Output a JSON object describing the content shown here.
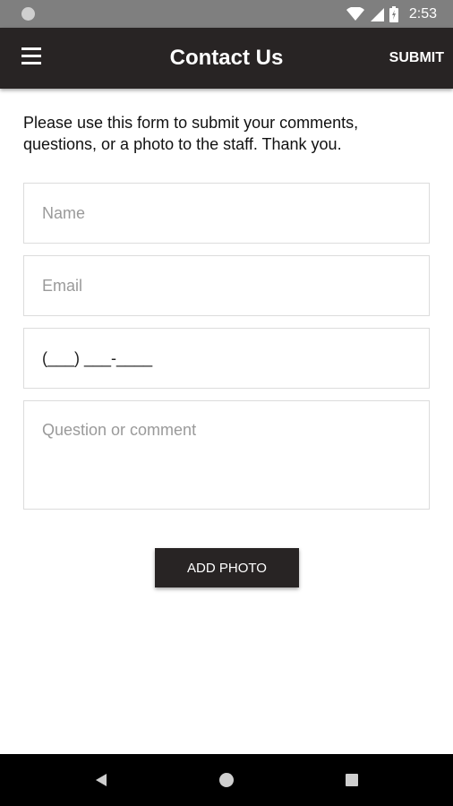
{
  "status_bar": {
    "time": "2:53"
  },
  "app_bar": {
    "title": "Contact Us",
    "submit_label": "SUBMIT"
  },
  "intro_text": "Please use this form to submit your comments, questions, or a photo to the staff. Thank you.",
  "form": {
    "name_placeholder": "Name",
    "email_placeholder": "Email",
    "phone_value": "(___) ___-____",
    "comment_placeholder": "Question or comment"
  },
  "add_photo_label": "ADD PHOTO",
  "icons": {
    "status_left": "notification-dot-icon",
    "wifi": "wifi-icon",
    "signal": "cell-signal-icon",
    "battery": "battery-icon",
    "menu": "menu-icon",
    "back": "back-icon",
    "home": "home-icon",
    "recents": "recents-icon"
  },
  "colors": {
    "app_bar": "#282424",
    "status_bar": "#7f7f7f",
    "nav_bar": "#000000",
    "button": "#282424"
  }
}
